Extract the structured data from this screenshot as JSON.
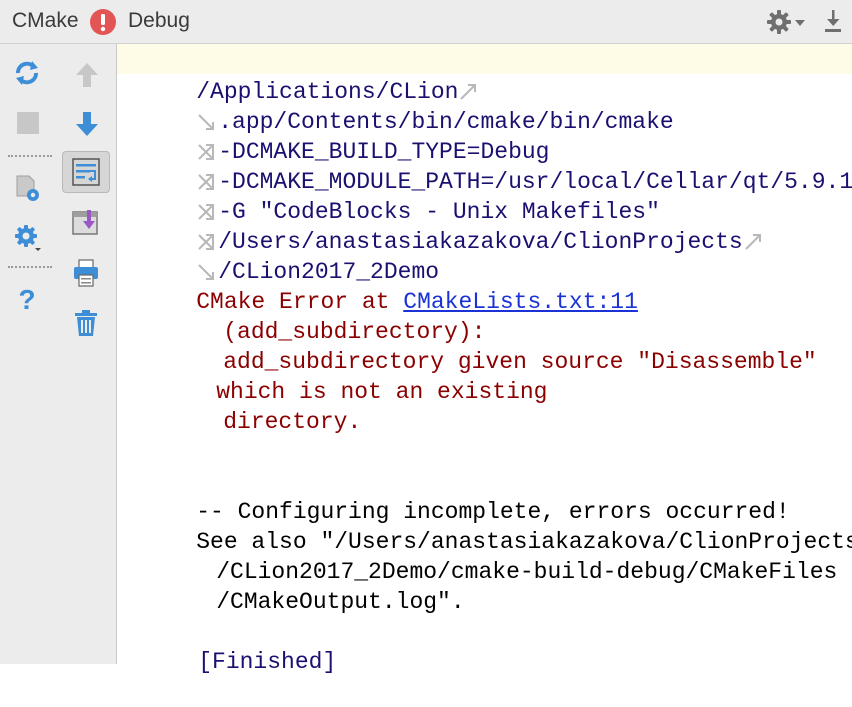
{
  "titlebar": {
    "title": "CMake",
    "config": "Debug",
    "icons": [
      "error-icon",
      "gear-icon",
      "chevron-down-icon",
      "download-icon"
    ]
  },
  "toolbar": {
    "icons": [
      "reload-icon",
      "stop-icon",
      "settings-file-icon",
      "gear-icon",
      "help-icon",
      "arrow-up-icon",
      "arrow-down-icon",
      "soft-wrap-icon",
      "scroll-to-end-icon",
      "print-icon",
      "trash-icon"
    ]
  },
  "console": {
    "cmd": [
      "/Applications/CLion",
      ".app/Contents/bin/cmake/bin/cmake",
      "-DCMAKE_BUILD_TYPE=Debug",
      "-DCMAKE_MODULE_PATH=/usr/local/Cellar/qt/5.9.1",
      "-G \"CodeBlocks - Unix Makefiles\"",
      "/Users/anastasiakazakova/ClionProjects",
      "/CLion2017_2Demo"
    ],
    "error": {
      "prefix": "CMake Error at ",
      "link": "CMakeLists.txt:11",
      "lines": [
        "(add_subdirectory):",
        "add_subdirectory given source \"Disassemble\"",
        "which is not an existing",
        "directory."
      ]
    },
    "output": [
      "-- Configuring incomplete, errors occurred!",
      "See also \"/Users/anastasiakazakova/ClionProjects",
      "/CLion2017_2Demo/cmake-build-debug/CMakeFiles",
      "/CMakeOutput.log\"."
    ],
    "finished": "[Finished]"
  },
  "colors": {
    "command": "#1a1070",
    "error": "#8b0000",
    "link": "#1a32d6",
    "current_line": "#fefbe6",
    "toolbar_blue": "#3d8ed6"
  }
}
